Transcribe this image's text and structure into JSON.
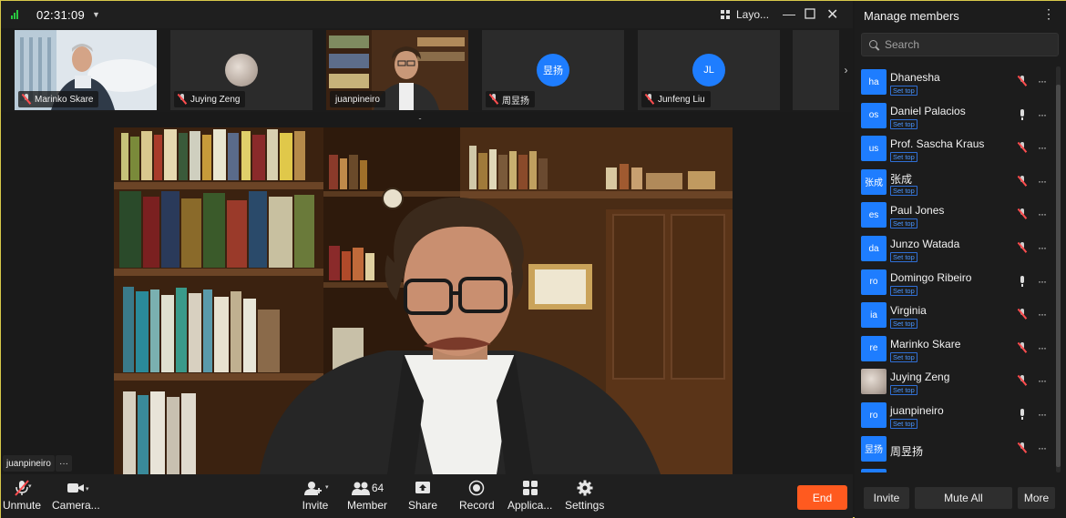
{
  "topbar": {
    "timer": "02:31:09",
    "layout_label": "Layo..."
  },
  "thumbnails": [
    {
      "name": "Marinko Skare",
      "kind": "video",
      "muted": true
    },
    {
      "name": "Juying Zeng",
      "kind": "photo-avatar",
      "muted": true
    },
    {
      "name": "juanpineiro",
      "kind": "video",
      "muted": false
    },
    {
      "name": "周昱扬",
      "kind": "initials",
      "initials": "昱扬",
      "muted": true
    },
    {
      "name": "Junfeng Liu",
      "kind": "initials",
      "initials": "JL",
      "muted": true
    }
  ],
  "main_speaker": {
    "name": "juanpineiro",
    "more": "···"
  },
  "toolbar": {
    "unmute": "Unmute",
    "camera": "Camera...",
    "invite": "Invite",
    "member": "Member",
    "member_count": "64",
    "share": "Share",
    "record": "Record",
    "apps": "Applica...",
    "settings": "Settings",
    "end": "End"
  },
  "panel": {
    "title": "Manage members",
    "search_placeholder": "Search",
    "set_top_label": "Set top",
    "members": [
      {
        "avatar": "ha",
        "name": "Dhanesha",
        "mic": "muted"
      },
      {
        "avatar": "os",
        "name": "Daniel Palacios",
        "mic": "on"
      },
      {
        "avatar": "us",
        "name": "Prof. Sascha Kraus",
        "mic": "muted"
      },
      {
        "avatar": "张成",
        "name": "张成",
        "mic": "muted"
      },
      {
        "avatar": "es",
        "name": "Paul Jones",
        "mic": "muted"
      },
      {
        "avatar": "da",
        "name": "Junzo Watada",
        "mic": "muted"
      },
      {
        "avatar": "ro",
        "name": "Domingo Ribeiro",
        "mic": "on"
      },
      {
        "avatar": "ia",
        "name": "Virginia",
        "mic": "muted"
      },
      {
        "avatar": "re",
        "name": "Marinko Skare",
        "mic": "muted"
      },
      {
        "avatar": "",
        "name": "Juying Zeng",
        "mic": "muted",
        "photo": true
      },
      {
        "avatar": "ro",
        "name": "juanpineiro",
        "mic": "on"
      },
      {
        "avatar": "昱扬",
        "name": "周昱扬",
        "mic": "muted",
        "no_settop": true
      }
    ],
    "invite": "Invite",
    "mute_all": "Mute All",
    "more": "More"
  }
}
